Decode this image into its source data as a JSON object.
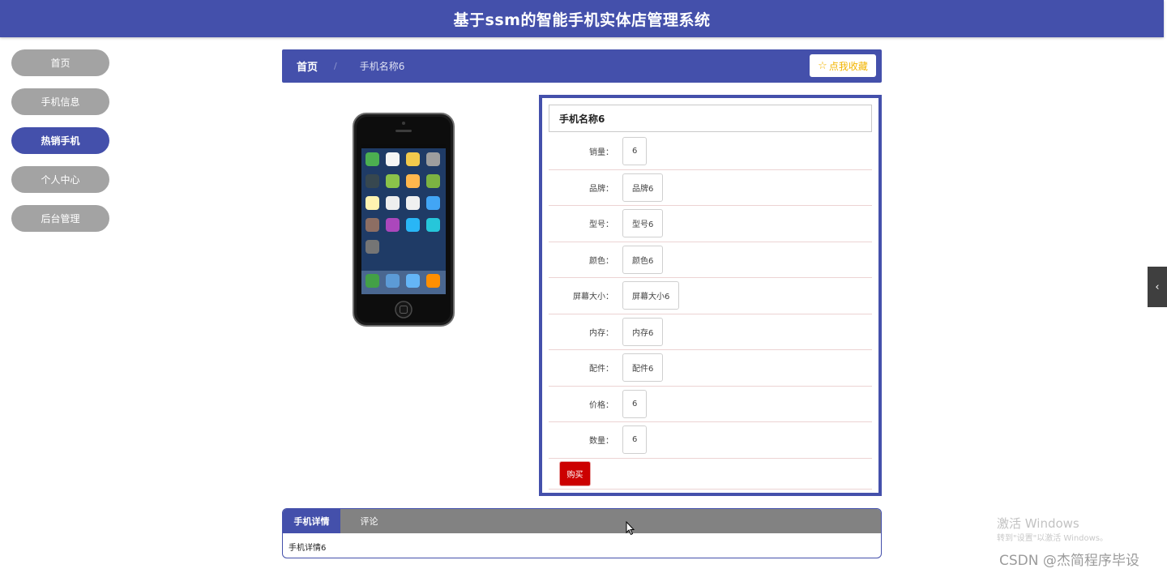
{
  "header": {
    "title": "基于ssm的智能手机实体店管理系统"
  },
  "sidebar": {
    "items": [
      {
        "label": "首页",
        "active": false
      },
      {
        "label": "手机信息",
        "active": false
      },
      {
        "label": "热销手机",
        "active": true
      },
      {
        "label": "个人中心",
        "active": false
      },
      {
        "label": "后台管理",
        "active": false
      }
    ]
  },
  "breadcrumb": {
    "home": "首页",
    "separator": "/",
    "current": "手机名称6"
  },
  "favorite_button": {
    "icon": "star-outline-icon",
    "label": "点我收藏"
  },
  "product": {
    "name": "手机名称6",
    "fields": [
      {
        "label": "销量：",
        "value": "6"
      },
      {
        "label": "品牌：",
        "value": "品牌6"
      },
      {
        "label": "型号：",
        "value": "型号6"
      },
      {
        "label": "颜色：",
        "value": "颜色6"
      },
      {
        "label": "屏幕大小：",
        "value": "屏幕大小6"
      },
      {
        "label": "内存：",
        "value": "内存6"
      },
      {
        "label": "配件：",
        "value": "配件6"
      },
      {
        "label": "价格：",
        "value": "6"
      },
      {
        "label": "数量：",
        "value": "6"
      }
    ],
    "buy_label": "购买"
  },
  "tabs": {
    "items": [
      {
        "label": "手机详情",
        "active": true
      },
      {
        "label": "评论",
        "active": false
      }
    ],
    "content": "手机详情6"
  },
  "watermark": {
    "title": "激活 Windows",
    "subtitle": "转到\"设置\"以激活 Windows。",
    "csdn": "CSDN @杰简程序毕设"
  },
  "colors": {
    "primary": "#4450ab",
    "nav_inactive": "#a3a3a3",
    "buy": "#cc0000",
    "favorite": "#f2b400"
  }
}
